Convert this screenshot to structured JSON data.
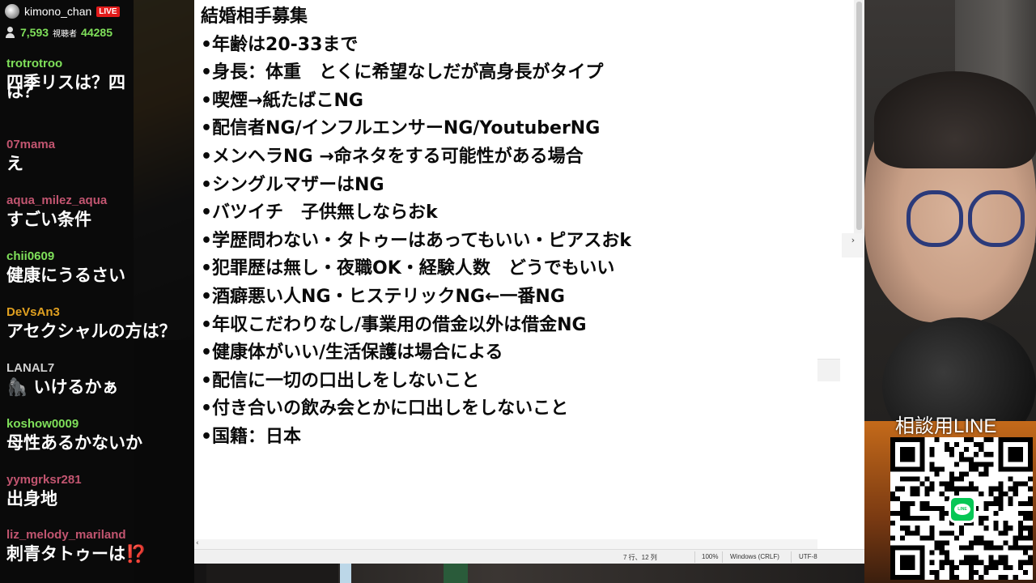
{
  "chat": {
    "channel_name": "kimono_chan",
    "live_badge": "LIVE",
    "viewer_count": "7,593",
    "viewer_label": "視聴者",
    "total_count": "44285",
    "messages": [
      {
        "user": "trotrotroo",
        "user_color": "#7fe05a",
        "text": "四季リスは？四"
      },
      {
        "user": "",
        "user_color": "#7fe05a",
        "text": "は？"
      },
      {
        "user": "07mama",
        "user_color": "#c25570",
        "text": "え"
      },
      {
        "user": "aqua_milez_aqua",
        "user_color": "#c25570",
        "text": "すごい条件"
      },
      {
        "user": "chii0609",
        "user_color": "#7fe05a",
        "text": "健康にうるさい"
      },
      {
        "user": "DeVsAn3",
        "user_color": "#e0a020",
        "text": "アセクシャルの方は？"
      },
      {
        "user": "LANAL7",
        "user_color": "#d0d0d0",
        "text": "🦍 いけるかぁ"
      },
      {
        "user": "koshow0009",
        "user_color": "#7fe05a",
        "text": "母性あるかないか"
      },
      {
        "user": "yymgrksr281",
        "user_color": "#c25570",
        "text": "出身地"
      },
      {
        "user": "liz_melody_mariland",
        "user_color": "#c25570",
        "text": "刺青タトゥーは⁉️"
      }
    ]
  },
  "notepad": {
    "lines": [
      "結婚相手募集",
      "•年齢は20-33まで",
      "•身長：体重　とくに希望なしだが高身長がタイプ",
      "•喫煙→紙たばこNG",
      "•配信者NG/インフルエンサーNG/YoutuberNG",
      "•メンヘラNG →命ネタをする可能性がある場合",
      "•シングルマザーはNG",
      "•バツイチ　子供無しならおk",
      "•学歴問わない・タトゥーはあってもいい・ピアスおk",
      "•犯罪歴は無し・夜職OK・経験人数　どうでもいい",
      "•酒癖悪い人NG・ヒステリックNG←一番NG",
      "•年収こだわりなし/事業用の借金以外は借金NG",
      "•健康体がいい/生活保護は場合による",
      "•配信に一切の口出しをしないこと",
      "•付き合いの飲み会とかに口出しをしないこと",
      "•国籍：日本"
    ],
    "status": {
      "position": "7 行、12 列",
      "zoom": "100%",
      "line_ending": "Windows (CRLF)",
      "encoding": "UTF-8"
    },
    "expand_glyph": "›",
    "scroll_left_glyph": "‹"
  },
  "overlay": {
    "qr_label": "相談用LINE",
    "line_logo_text": "LINE"
  }
}
